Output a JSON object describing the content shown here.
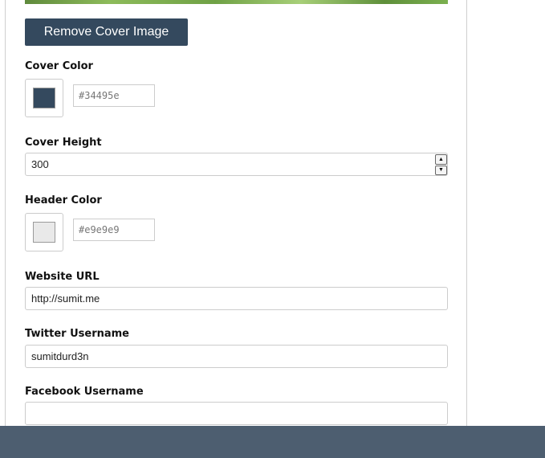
{
  "remove_cover_button": "Remove Cover Image",
  "cover_color": {
    "label": "Cover Color",
    "value": "#34495e",
    "swatch_color": "#34495e"
  },
  "cover_height": {
    "label": "Cover Height",
    "value": "300"
  },
  "header_color": {
    "label": "Header Color",
    "value": "#e9e9e9",
    "swatch_color": "#e9e9e9"
  },
  "website_url": {
    "label": "Website URL",
    "value": "http://sumit.me"
  },
  "twitter_username": {
    "label": "Twitter Username",
    "value": "sumitdurd3n"
  },
  "facebook_username": {
    "label": "Facebook Username",
    "value": ""
  },
  "colors": {
    "button_bg": "#34495e",
    "footer_bar": "#4d5e70"
  }
}
